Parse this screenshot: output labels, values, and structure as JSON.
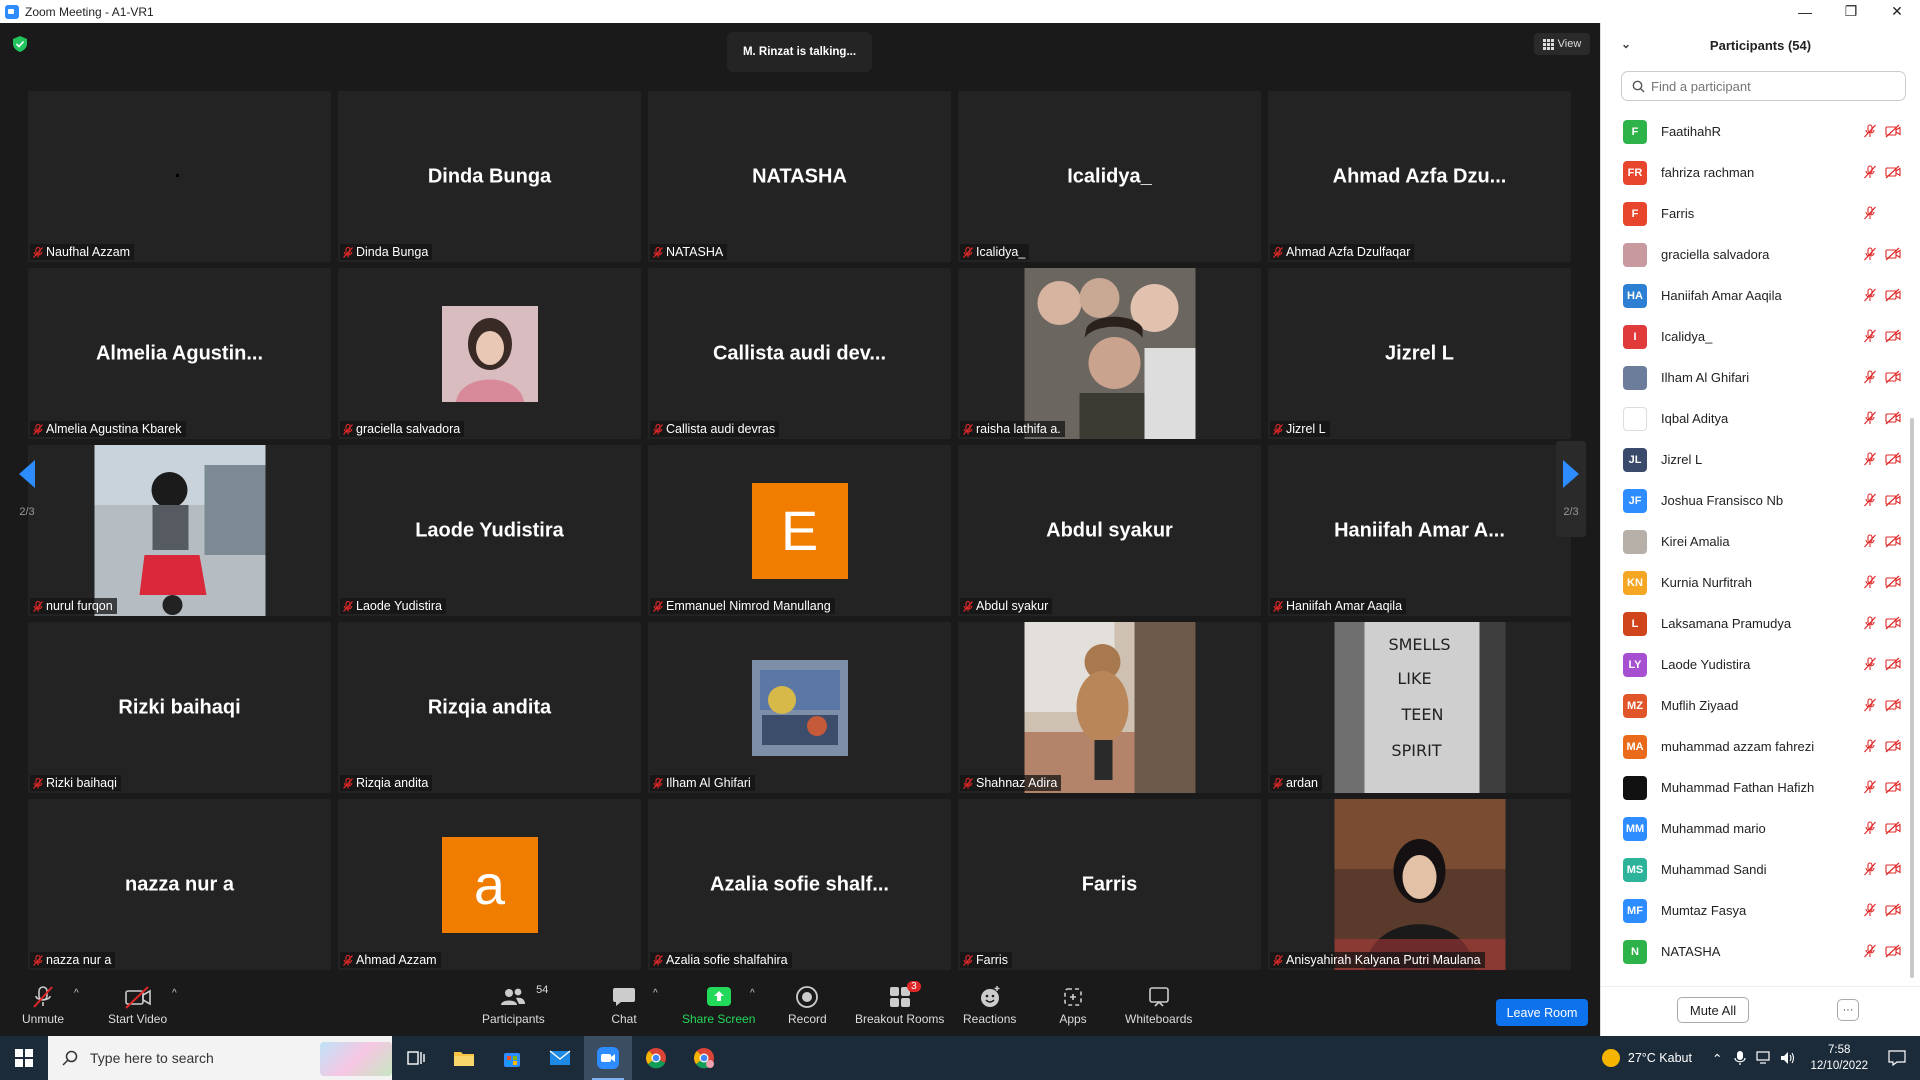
{
  "window": {
    "title": "Zoom Meeting - A1-VR1",
    "minimize": "—",
    "maximize": "❐",
    "close": "✕"
  },
  "meeting": {
    "talking": "M. Rinzat is talking...",
    "view_label": "View",
    "page_indicator": "2/3"
  },
  "tiles": [
    {
      "big": "",
      "label": "Naufhal Azzam",
      "type": "dot"
    },
    {
      "big": "Dinda Bunga",
      "label": "Dinda Bunga",
      "type": "name"
    },
    {
      "big": "NATASHA",
      "label": "NATASHA",
      "type": "name"
    },
    {
      "big": "Icalidya_",
      "label": "Icalidya_",
      "type": "name"
    },
    {
      "big": "Ahmad Azfa Dzu...",
      "label": "Ahmad Azfa Dzulfaqar",
      "type": "name"
    },
    {
      "big": "Almelia Agustin...",
      "label": "Almelia Agustina Kbarek",
      "type": "name"
    },
    {
      "big": "",
      "label": "graciella salvadora",
      "type": "photo-sm",
      "photo": "girl-portrait"
    },
    {
      "big": "Callista audi dev...",
      "label": "Callista audi devras",
      "type": "name"
    },
    {
      "big": "",
      "label": "raisha lathifa a.",
      "type": "photo",
      "photo": "band-group-photo"
    },
    {
      "big": "Jizrel L",
      "label": "Jizrel L",
      "type": "name"
    },
    {
      "big": "",
      "label": "nurul furqon",
      "type": "photo",
      "photo": "motorbike-rider"
    },
    {
      "big": "Laode Yudistira",
      "label": "Laode Yudistira",
      "type": "name"
    },
    {
      "big": "E",
      "label": "Emmanuel Nimrod Manullang",
      "type": "avatar"
    },
    {
      "big": "Abdul syakur",
      "label": "Abdul syakur",
      "type": "name"
    },
    {
      "big": "Haniifah Amar A...",
      "label": "Haniifah Amar Aaqila",
      "type": "name"
    },
    {
      "big": "Rizki baihaqi",
      "label": "Rizki baihaqi",
      "type": "name"
    },
    {
      "big": "Rizqia andita",
      "label": "Rizqia andita",
      "type": "name"
    },
    {
      "big": "",
      "label": "Ilham Al Ghifari",
      "type": "photo-sm",
      "photo": "painting"
    },
    {
      "big": "",
      "label": "Shahnaz Adira",
      "type": "photo",
      "photo": "teddy-bear"
    },
    {
      "big": "",
      "label": "ardan",
      "type": "photo",
      "photo": "smells-like-teen-spirit-shirt"
    },
    {
      "big": "nazza nur a",
      "label": "nazza nur a",
      "type": "name"
    },
    {
      "big": "a",
      "label": "Ahmad Azzam",
      "type": "avatar"
    },
    {
      "big": "Azalia sofie shalf...",
      "label": "Azalia sofie shalfahira",
      "type": "name"
    },
    {
      "big": "Farris",
      "label": "Farris",
      "type": "name"
    },
    {
      "big": "",
      "label": "Anisyahirah Kalyana Putri Maulana",
      "type": "photo",
      "photo": "woman-portrait"
    }
  ],
  "toolbar": {
    "unmute": "Unmute",
    "start_video": "Start Video",
    "participants": "Participants",
    "participants_count": "54",
    "chat": "Chat",
    "share_screen": "Share Screen",
    "record": "Record",
    "breakout_rooms": "Breakout Rooms",
    "breakout_badge": "3",
    "reactions": "Reactions",
    "apps": "Apps",
    "whiteboards": "Whiteboards",
    "leave_room": "Leave Room"
  },
  "panel": {
    "title": "Participants (54)",
    "search_placeholder": "Find a participant",
    "mute_all": "Mute All",
    "more": "···",
    "participants": [
      {
        "initials": "F",
        "name": "FaatihahR",
        "color": "#2db34a",
        "video_off": true
      },
      {
        "initials": "FR",
        "name": "fahriza rachman",
        "color": "#e8462c",
        "video_off": true
      },
      {
        "initials": "F",
        "name": "Farris",
        "color": "#e8462c",
        "video_off": false
      },
      {
        "initials": "",
        "name": "graciella salvadora",
        "color": "#c89aa0",
        "video_off": true
      },
      {
        "initials": "HA",
        "name": "Haniifah Amar Aaqila",
        "color": "#2d7fd3",
        "video_off": true
      },
      {
        "initials": "I",
        "name": "Icalidya_",
        "color": "#e03a3a",
        "video_off": true
      },
      {
        "initials": "",
        "name": "Ilham Al Ghifari",
        "color": "#6b7d9a",
        "video_off": true
      },
      {
        "initials": "",
        "name": "Iqbal Aditya",
        "color": "#ffffff",
        "video_off": true
      },
      {
        "initials": "JL",
        "name": "Jizrel L",
        "color": "#3a4a6b",
        "video_off": true
      },
      {
        "initials": "JF",
        "name": "Joshua Fransisco Nb",
        "color": "#2d8cff",
        "video_off": true
      },
      {
        "initials": "",
        "name": "Kirei Amalia",
        "color": "#b6b0a8",
        "video_off": true
      },
      {
        "initials": "KN",
        "name": "Kurnia Nurfitrah",
        "color": "#f5a623",
        "video_off": true
      },
      {
        "initials": "L",
        "name": "Laksamana Pramudya",
        "color": "#d0451b",
        "video_off": true
      },
      {
        "initials": "LY",
        "name": "Laode Yudistira",
        "color": "#a64fd1",
        "video_off": true
      },
      {
        "initials": "MZ",
        "name": "Muflih Ziyaad",
        "color": "#e0562a",
        "video_off": true
      },
      {
        "initials": "MA",
        "name": "muhammad azzam fahrezi",
        "color": "#e86a1a",
        "video_off": true
      },
      {
        "initials": "",
        "name": "Muhammad Fathan Hafizh",
        "color": "#111111",
        "video_off": true
      },
      {
        "initials": "MM",
        "name": "Muhammad mario",
        "color": "#2d8cff",
        "video_off": true
      },
      {
        "initials": "MS",
        "name": "Muhammad Sandi",
        "color": "#2db39a",
        "video_off": true
      },
      {
        "initials": "MF",
        "name": "Mumtaz Fasya",
        "color": "#2d8cff",
        "video_off": true
      },
      {
        "initials": "N",
        "name": "NATASHA",
        "color": "#2db34a",
        "video_off": true
      }
    ]
  },
  "taskbar": {
    "search_placeholder": "Type here to search",
    "weather": "27°C  Kabut",
    "time": "7:58",
    "date": "12/10/2022"
  },
  "colors": {
    "accent": "#2d8cff",
    "leave": "#0e72ed",
    "mic_muted": "#e02828",
    "avatar_orange": "#f07c00"
  }
}
